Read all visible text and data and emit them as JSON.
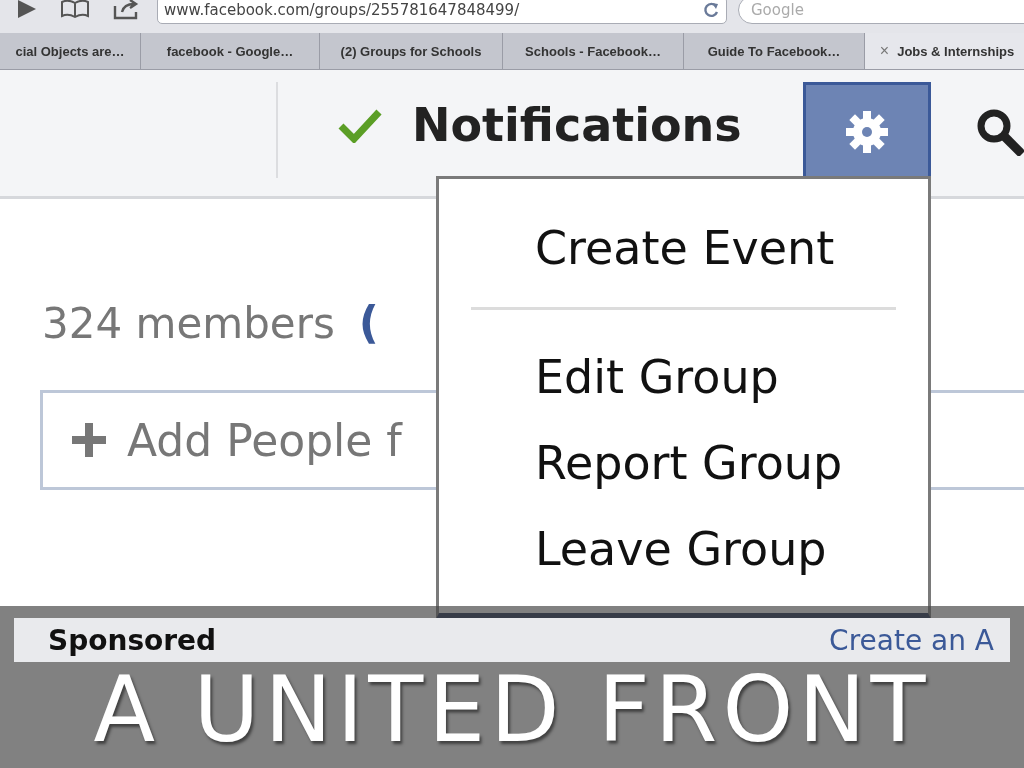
{
  "browser": {
    "address": "www.facebook.com/groups/255781647848499/",
    "search": {
      "placeholder": "Google"
    },
    "tabs": [
      {
        "label": "cial Objects are…",
        "selected": false
      },
      {
        "label": "facebook - Google…",
        "selected": false
      },
      {
        "label": "(2) Groups for Schools",
        "selected": false
      },
      {
        "label": "Schools - Facebook…",
        "selected": false
      },
      {
        "label": "Guide To Facebook…",
        "selected": false
      },
      {
        "label": "Jobs & Internships",
        "selected": true,
        "close": "×"
      }
    ]
  },
  "header": {
    "notifications": "Notifications"
  },
  "group": {
    "members": "324 members",
    "members_extra": "(",
    "add_people": {
      "placeholder": "Add People f"
    }
  },
  "settings_menu": {
    "items": [
      {
        "kind": "item",
        "label": "Create Event"
      },
      {
        "kind": "separator"
      },
      {
        "kind": "item",
        "label": "Edit Group"
      },
      {
        "kind": "item",
        "label": "Report Group"
      },
      {
        "kind": "item",
        "label": "Leave Group"
      }
    ]
  },
  "sponsored": {
    "title": "Sponsored",
    "link": "Create an A"
  },
  "slide_title": "A UNITED FRONT"
}
